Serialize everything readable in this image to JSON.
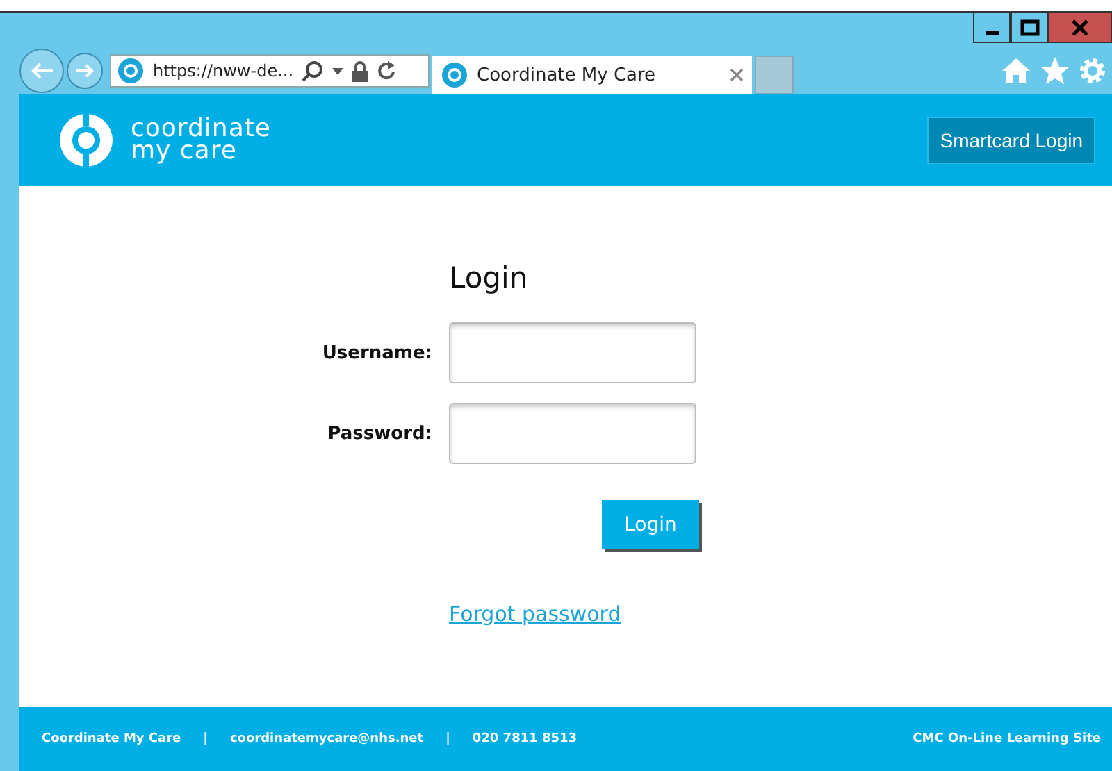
{
  "browser": {
    "address": "https://nww-de...",
    "tab": {
      "title": "Coordinate My Care",
      "selected": true
    }
  },
  "header": {
    "logo_line_1": "coordinate",
    "logo_line_2": "my care",
    "smartcard_button": "Smartcard Login"
  },
  "login": {
    "title": "Login",
    "fields": [
      {
        "label": "Username:"
      },
      {
        "label": "Password:"
      }
    ],
    "submit": "Login",
    "forgot_link": "Forgot password"
  },
  "footer": {
    "items": [
      "Coordinate My Care",
      "|",
      "coordinatemycare@nhs.net",
      "|",
      "020 7811 8513"
    ],
    "right_link": "CMC On-Line Learning Site"
  }
}
